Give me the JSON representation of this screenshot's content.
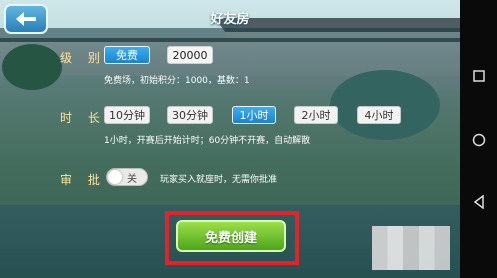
{
  "header": {
    "title": "好友房",
    "back_icon": "back-arrow-icon"
  },
  "level": {
    "label": "级 别",
    "options": [
      {
        "label": "免费",
        "selected": true
      }
    ],
    "value": "20000",
    "description": "免费场，初始积分：1000，基数：1"
  },
  "duration": {
    "label": "时 长",
    "options": [
      {
        "label": "10分钟",
        "selected": false
      },
      {
        "label": "30分钟",
        "selected": false
      },
      {
        "label": "1小时",
        "selected": true
      },
      {
        "label": "2小时",
        "selected": false
      },
      {
        "label": "4小时",
        "selected": false
      }
    ],
    "description": "1小时，开赛后开始计时；60分钟不开赛，自动解散"
  },
  "approval": {
    "label": "审 批",
    "toggle_text": "关",
    "toggle_on": false,
    "description": "玩家买入就座时，无需你批准"
  },
  "create_button": {
    "label": "免费创建"
  },
  "navbar": {
    "icons": [
      "square-icon",
      "circle-icon",
      "triangle-back-icon"
    ]
  },
  "colors": {
    "accent_blue": "#1b82d2",
    "create_green": "#4ea51a",
    "highlight_red": "#e4222b",
    "label_yellow": "#ffe49a"
  }
}
